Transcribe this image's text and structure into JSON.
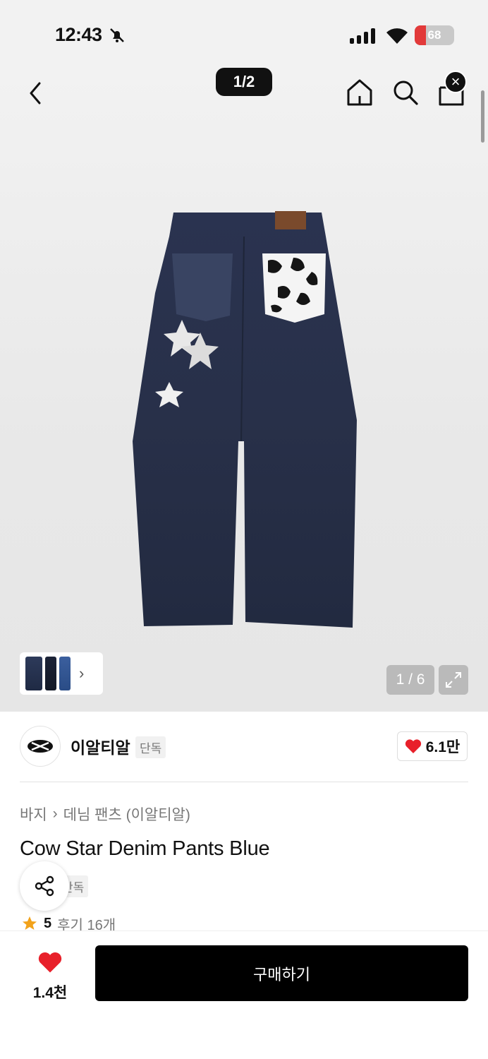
{
  "status_bar": {
    "time": "12:43",
    "battery": "68"
  },
  "header": {
    "page_indicator": "1/2"
  },
  "gallery": {
    "counter": "1 / 6"
  },
  "brand": {
    "name": "이알티알",
    "tag": "단독",
    "likes": "6.1만"
  },
  "product": {
    "breadcrumb": [
      "바지",
      "데님 팬츠 (이알티알)"
    ],
    "title": "Cow Star Denim Pants Blue",
    "tag": "단독",
    "rating": "5",
    "reviews": "후기 16개"
  },
  "bottom": {
    "wish_count": "1.4천",
    "buy_label": "구매하기"
  },
  "colors": {
    "accent": "#000000",
    "heart": "#e8202a",
    "star": "#f2a21a"
  }
}
